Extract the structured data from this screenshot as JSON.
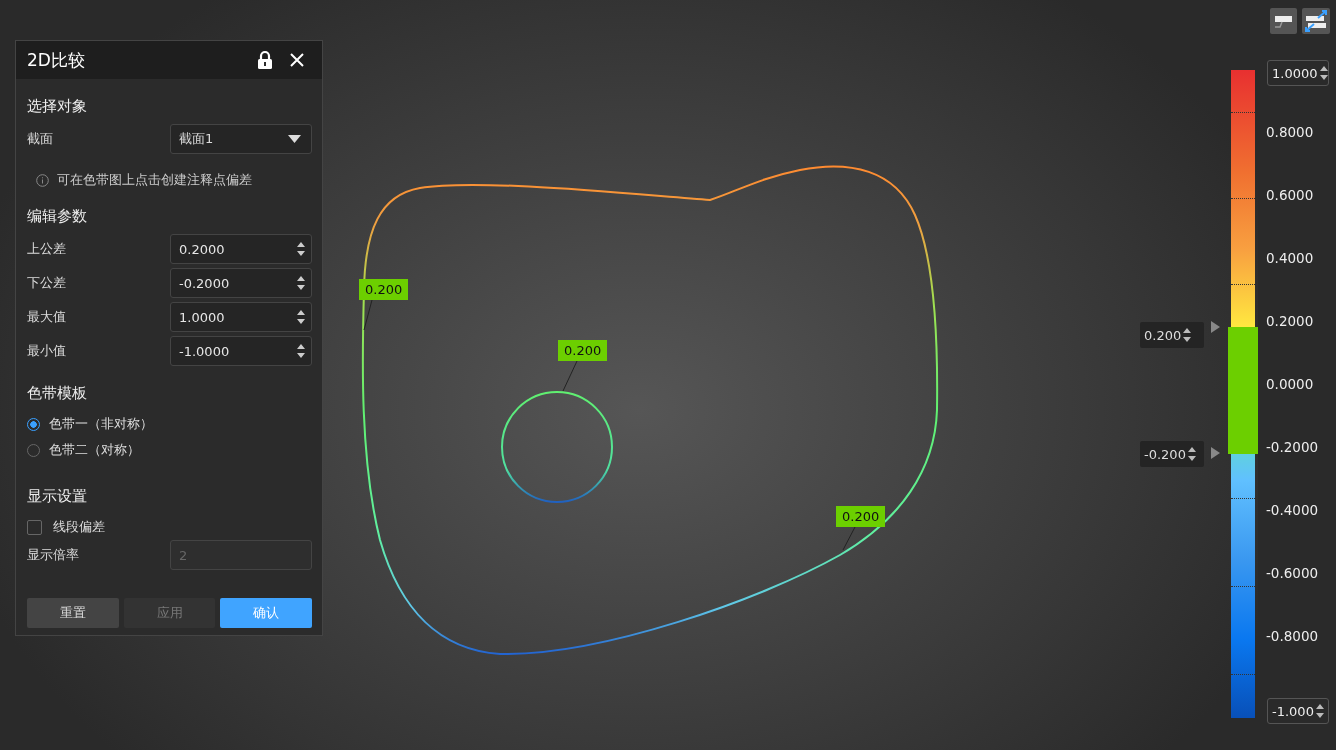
{
  "panel": {
    "title": "2D比较",
    "sections": [
      {
        "title": "选择对象"
      },
      {
        "title": "编辑参数"
      },
      {
        "title": "色带模板"
      },
      {
        "title": "显示设置"
      }
    ],
    "section_select": {
      "label": "截面",
      "value": "截面1",
      "hint": "可在色带图上点击创建注释点偏差"
    },
    "params": [
      {
        "label": "上公差",
        "value": "0.2000"
      },
      {
        "label": "下公差",
        "value": "-0.2000"
      },
      {
        "label": "最大值",
        "value": "1.0000"
      },
      {
        "label": "最小值",
        "value": "-1.0000"
      }
    ],
    "templates": [
      {
        "label": "色带一（非对称）",
        "selected": true
      },
      {
        "label": "色带二（对称）",
        "selected": false
      }
    ],
    "segment_deviation": {
      "label": "线段偏差",
      "checked": false
    },
    "scale": {
      "label": "显示倍率",
      "value": "2",
      "disabled": true
    },
    "buttons": [
      {
        "label": "重置",
        "kind": "secondary",
        "disabled": false
      },
      {
        "label": "应用",
        "kind": "secondary",
        "disabled": true
      },
      {
        "label": "确认",
        "kind": "primary",
        "disabled": false
      }
    ]
  },
  "annotations": [
    {
      "value": "0.200"
    },
    {
      "value": "0.200"
    },
    {
      "value": "0.200"
    }
  ],
  "legend": {
    "max": "1.0000",
    "min": "-1.000",
    "upper_tolerance": "0.200",
    "lower_tolerance": "-0.200",
    "ticks": [
      "0.8000",
      "0.6000",
      "0.4000",
      "0.2000",
      "0.0000",
      "-0.2000",
      "-0.4000",
      "-0.6000",
      "-0.8000"
    ]
  }
}
